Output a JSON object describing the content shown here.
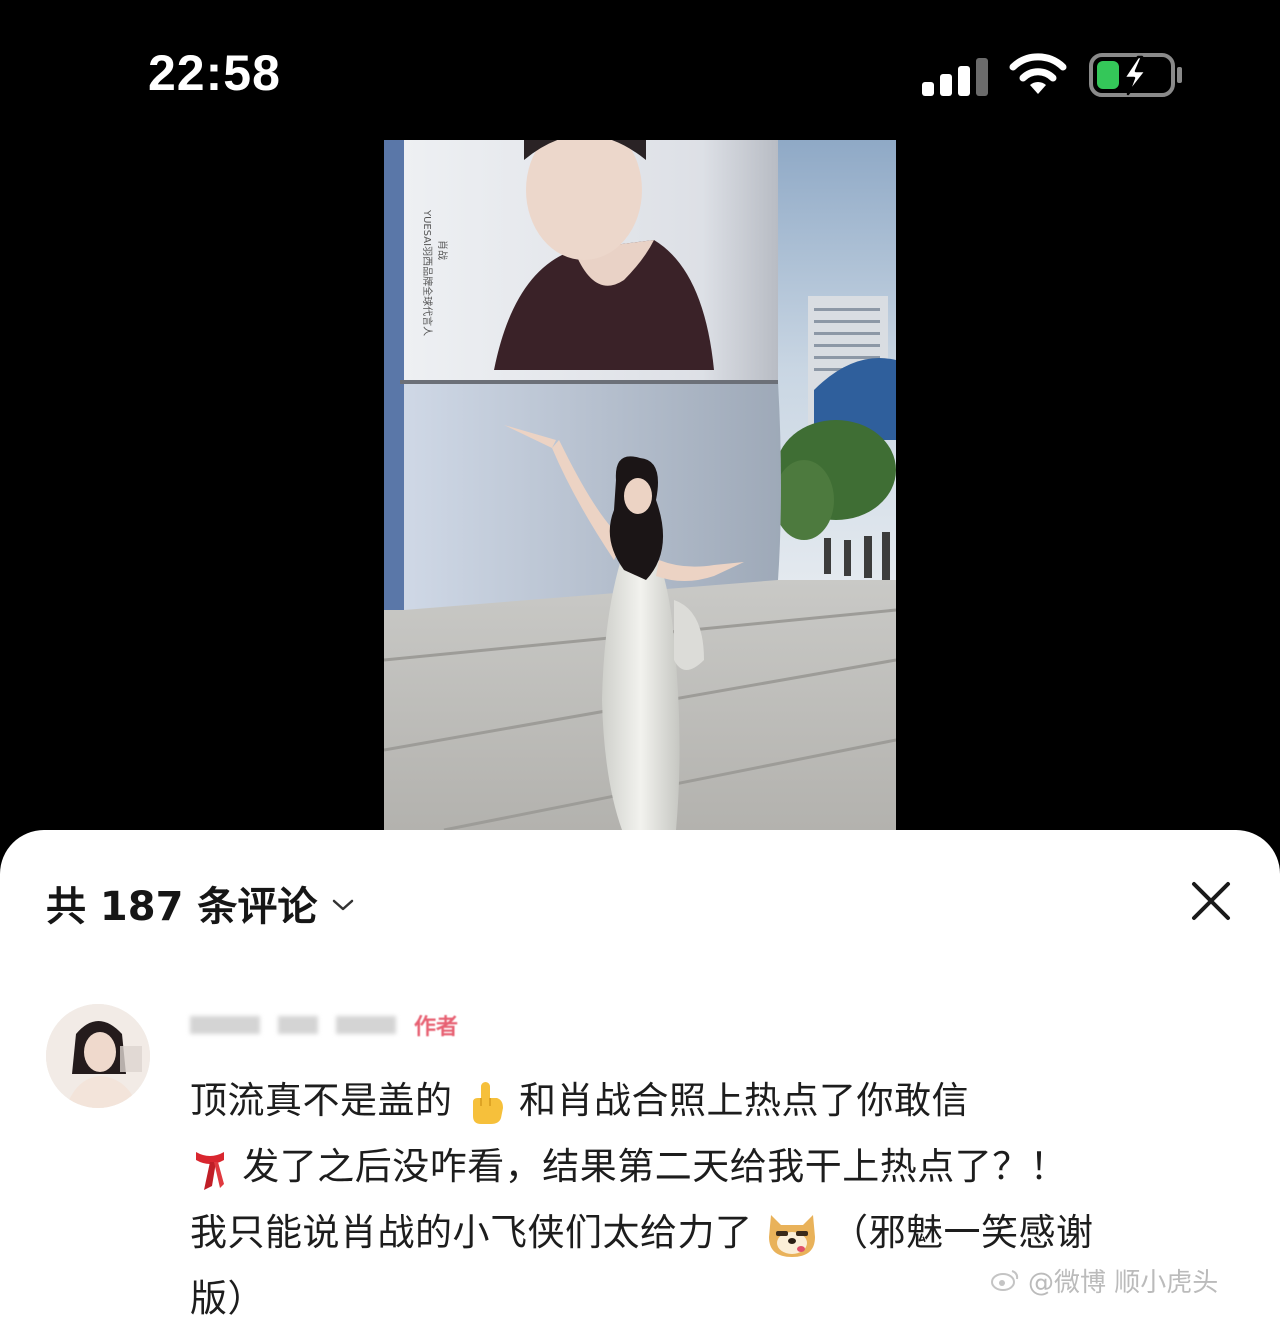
{
  "status_bar": {
    "time": "22:58",
    "icons": [
      "signal-icon",
      "wifi-icon",
      "battery-charging-icon"
    ]
  },
  "photo": {
    "poster_text": [
      "YUESAI羽西品牌全球代言人",
      "肖战"
    ]
  },
  "comments_sheet": {
    "title": "共 187 条评论",
    "close_icon": "close-icon",
    "comment": {
      "author_badge": "作者",
      "line1_a": "顶流真不是盖的",
      "line1_b": "和肖战合照上热点了你敢信",
      "line2": "发了之后没咋看，结果第二天给我干上热点了？！",
      "line3_a": "我只能说肖战的小飞侠们太给力了",
      "line3_b": "（邪魅一笑感谢",
      "line4": "版）"
    },
    "watermark_text": "@微博 顺小虎头"
  },
  "colors": {
    "background": "#000000",
    "sheet": "#ffffff",
    "text": "#1d1d1d",
    "author_badge": "#e3455a",
    "battery_green": "#34c759"
  }
}
